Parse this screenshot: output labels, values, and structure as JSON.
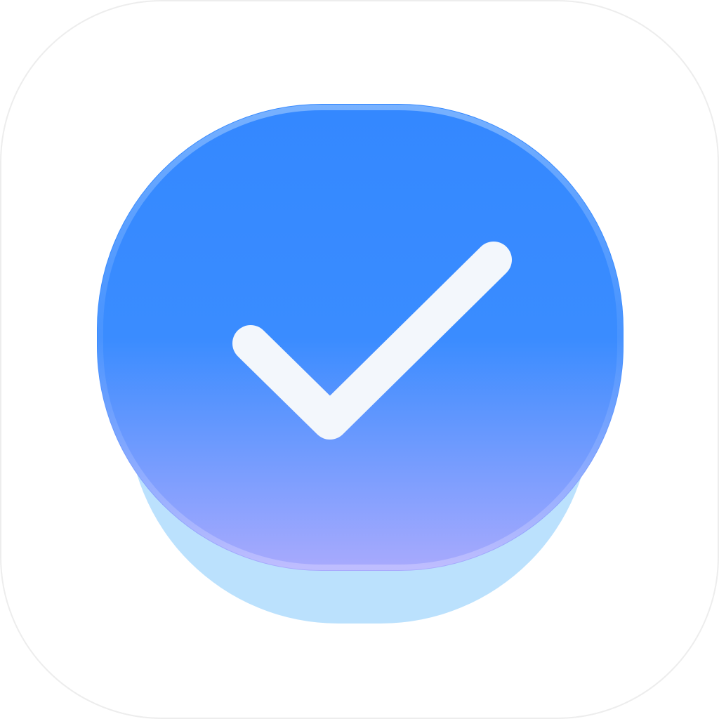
{
  "icon": {
    "name": "checkmark-app-icon",
    "glyph": "check-icon",
    "colors": {
      "tile_background": "#FFFFFF",
      "tile_border": "#EDEDED",
      "shadow_base": "#BBE1FD",
      "button_top": "#3488FF",
      "button_mid": "#3A8CFF",
      "button_bottom": "#A9AAFD",
      "button_edge": "#4A8FF5",
      "check_stroke": "#F3F7FC"
    }
  }
}
